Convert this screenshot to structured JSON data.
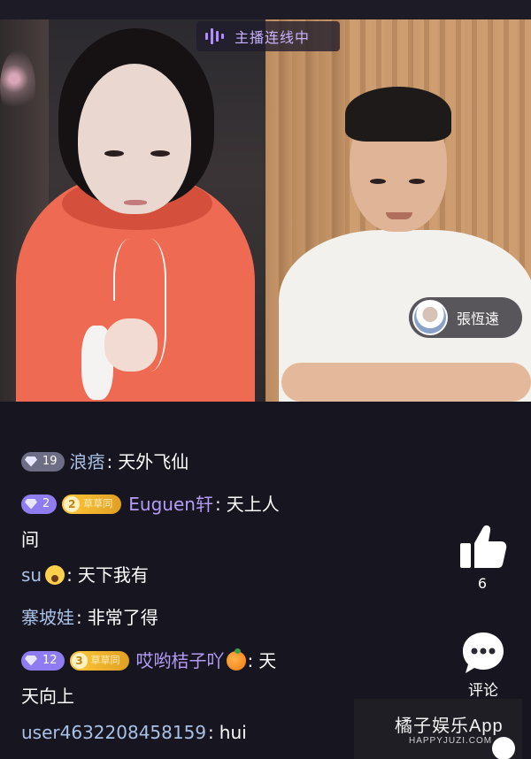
{
  "live": {
    "link_status": "主播连线中",
    "guest_name": "張恆遠"
  },
  "comments": [
    {
      "level": "19",
      "user": "浪痞",
      "text": "天外飞仙"
    },
    {
      "level": "2",
      "fan_level": "2",
      "fan_club": "草草同",
      "user": "Euguen轩",
      "text_line1": "天上人",
      "text_line2": "间"
    },
    {
      "user": "su",
      "text": "天下我有"
    },
    {
      "user": "寨坡娃",
      "text": "非常了得"
    },
    {
      "level": "12",
      "fan_level": "3",
      "fan_club": "草草同",
      "user": "哎哟桔子吖",
      "text_line1": "天",
      "text_line2": "天向上"
    },
    {
      "user": "user4632208458159",
      "text": "hui"
    }
  ],
  "actions": {
    "like_count": "6",
    "comment_label": "评论"
  },
  "watermark": {
    "title": "橘子娱乐App",
    "url": "HAPPYJUZI.COM"
  },
  "colors": {
    "background": "#17151f",
    "username_blue": "#a9c1e6",
    "username_purple": "#b49cf6",
    "badge_violet": "#8e7cf0",
    "badge_gold": "#ffc83a",
    "live_badge_text": "#c8b2ff"
  }
}
